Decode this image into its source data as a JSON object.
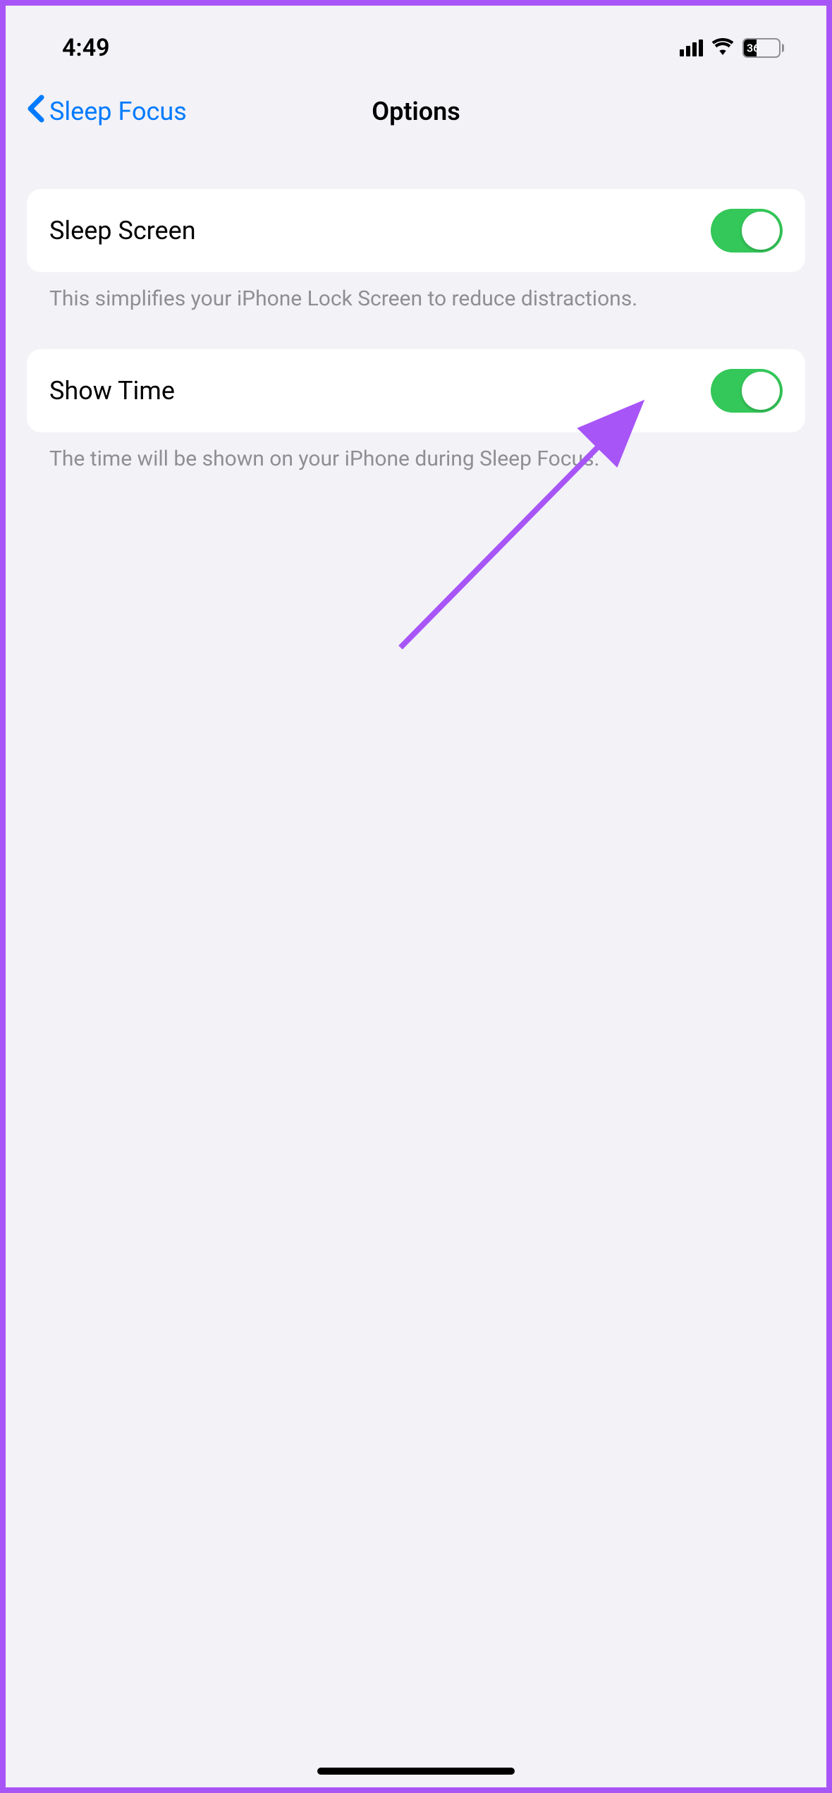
{
  "status_bar": {
    "time": "4:49",
    "battery_percent": "36"
  },
  "nav": {
    "back_label": "Sleep Focus",
    "title": "Options"
  },
  "settings": {
    "sleep_screen": {
      "label": "Sleep Screen",
      "description": "This simplifies your iPhone Lock Screen to reduce distractions.",
      "enabled": true
    },
    "show_time": {
      "label": "Show Time",
      "description": "The time will be shown on your iPhone during Sleep Focus.",
      "enabled": true
    }
  },
  "colors": {
    "link": "#007aff",
    "toggle_on": "#34c759",
    "annotation": "#a855f7",
    "background": "#f2f2f7"
  }
}
